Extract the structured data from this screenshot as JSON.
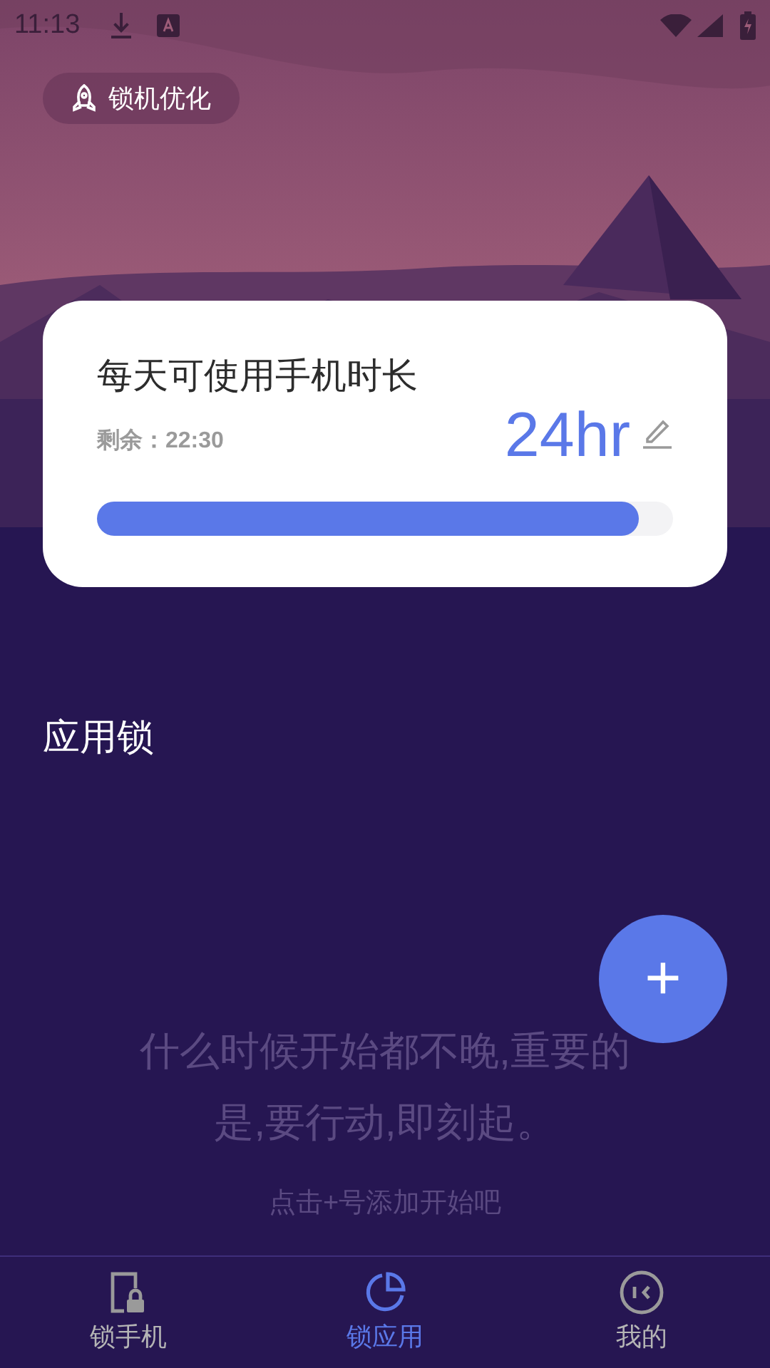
{
  "status_bar": {
    "time": "11:13"
  },
  "optimize_button": {
    "label": "锁机优化"
  },
  "usage_card": {
    "title": "每天可使用手机时长",
    "remaining": "剩余：22:30",
    "limit": "24hr",
    "level": 0.94
  },
  "section_title": "应用锁",
  "empty_state": {
    "message": "什么时候开始都不晚,重要的是,要行动,即刻起。",
    "hint": "点击+号添加开始吧"
  },
  "fab": {
    "label": "+"
  },
  "bottom_nav": [
    {
      "kind": "phone-lock",
      "label": "锁手机",
      "selected": false
    },
    {
      "kind": "pie",
      "label": "锁应用",
      "selected": true
    },
    {
      "kind": "face",
      "label": "我的",
      "selected": false
    }
  ]
}
